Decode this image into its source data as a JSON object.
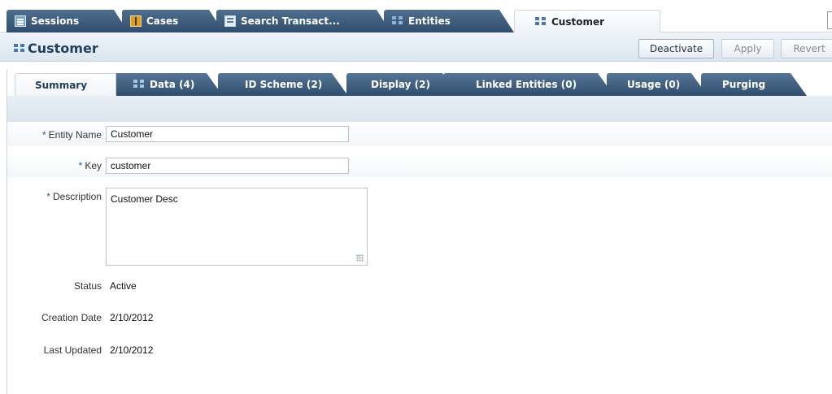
{
  "top_tabs": [
    {
      "label": "Sessions",
      "icon": "sessions-icon"
    },
    {
      "label": "Cases",
      "icon": "cases-icon"
    },
    {
      "label": "Search Transact...",
      "icon": "search-transactions-icon"
    },
    {
      "label": "Entities",
      "icon": "entities-icon"
    },
    {
      "label": "Customer",
      "icon": "customer-entity-icon",
      "active": true
    }
  ],
  "header": {
    "title": "Customer",
    "deactivate_label": "Deactivate",
    "apply_label": "Apply",
    "revert_label": "Revert"
  },
  "sub_tabs": [
    {
      "label": "Summary",
      "active": true
    },
    {
      "label": "Data (4)"
    },
    {
      "label": "ID Scheme (2)"
    },
    {
      "label": "Display (2)"
    },
    {
      "label": "Linked Entities (0)"
    },
    {
      "label": "Usage (0)"
    },
    {
      "label": "Purging"
    }
  ],
  "form": {
    "required_marker": "*",
    "entity_name_label": "Entity Name",
    "entity_name_value": "Customer",
    "key_label": "Key",
    "key_value": "customer",
    "description_label": "Description",
    "description_value": "Customer Desc",
    "status_label": "Status",
    "status_value": "Active",
    "creation_date_label": "Creation Date",
    "creation_date_value": "2/10/2012",
    "last_updated_label": "Last Updated",
    "last_updated_value": "2/10/2012"
  },
  "colors": {
    "tab_dark": "#2f4d6d",
    "title_text": "#1f3e60",
    "required_marker": "#1d5ea8"
  }
}
